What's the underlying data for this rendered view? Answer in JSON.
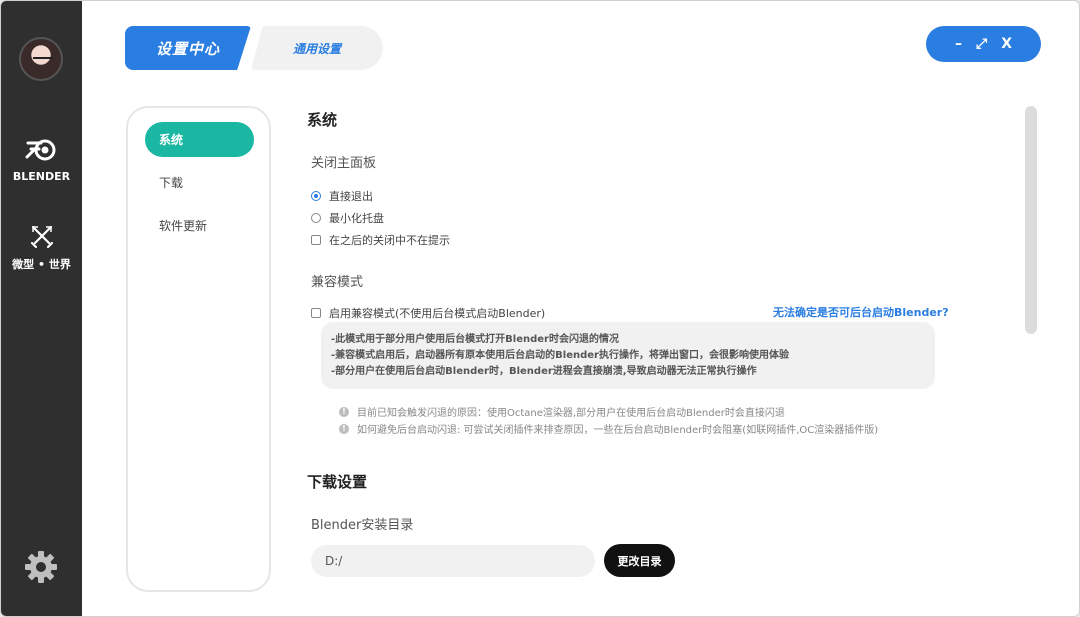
{
  "rail": {
    "blender_label": "BLENDER",
    "world_label": "微型 • 世界"
  },
  "header": {
    "tab_active": "设置中心",
    "tab_inactive": "通用设置",
    "controls": {
      "minimize": "–",
      "maximize": "⤢",
      "close": "X"
    }
  },
  "subnav": {
    "items": [
      {
        "label": "系统"
      },
      {
        "label": "下载"
      },
      {
        "label": "软件更新"
      }
    ]
  },
  "system": {
    "title": "系统",
    "close_panel": {
      "title": "关闭主面板",
      "options": [
        "直接退出",
        "最小化托盘"
      ],
      "selected": "直接退出",
      "no_prompt": "在之后的关闭中不在提示"
    },
    "compat": {
      "title": "兼容模式",
      "checkbox": "启用兼容模式(不使用后台模式启动Blender)",
      "link": "无法确定是否可后台启动Blender?",
      "notes": [
        "-此模式用于部分用户使用后台模式打开Blender时会闪退的情况",
        "-兼容模式启用后，启动器所有原本使用后台启动的Blender执行操作，将弹出窗口，会很影响使用体验",
        "-部分用户在使用后台启动Blender时，Blender进程会直接崩溃,导致启动器无法正常执行操作"
      ],
      "hints": [
        "目前已知会触发闪退的原因：使用Octane渲染器,部分用户在使用后台启动Blender时会直接闪退",
        "如何避免后台启动闪退: 可尝试关闭插件来排查原因，一些在后台启动Blender时会阻塞(如联网插件,OC渲染器插件版)"
      ]
    }
  },
  "download": {
    "title": "下载设置",
    "install_dir_label": "Blender安装目录",
    "install_dir_value": "D:/",
    "change_button": "更改目录"
  },
  "colors": {
    "accent": "#2a7de1",
    "subnav_active": "#1ab7a2",
    "rail": "#2f2f2f"
  }
}
